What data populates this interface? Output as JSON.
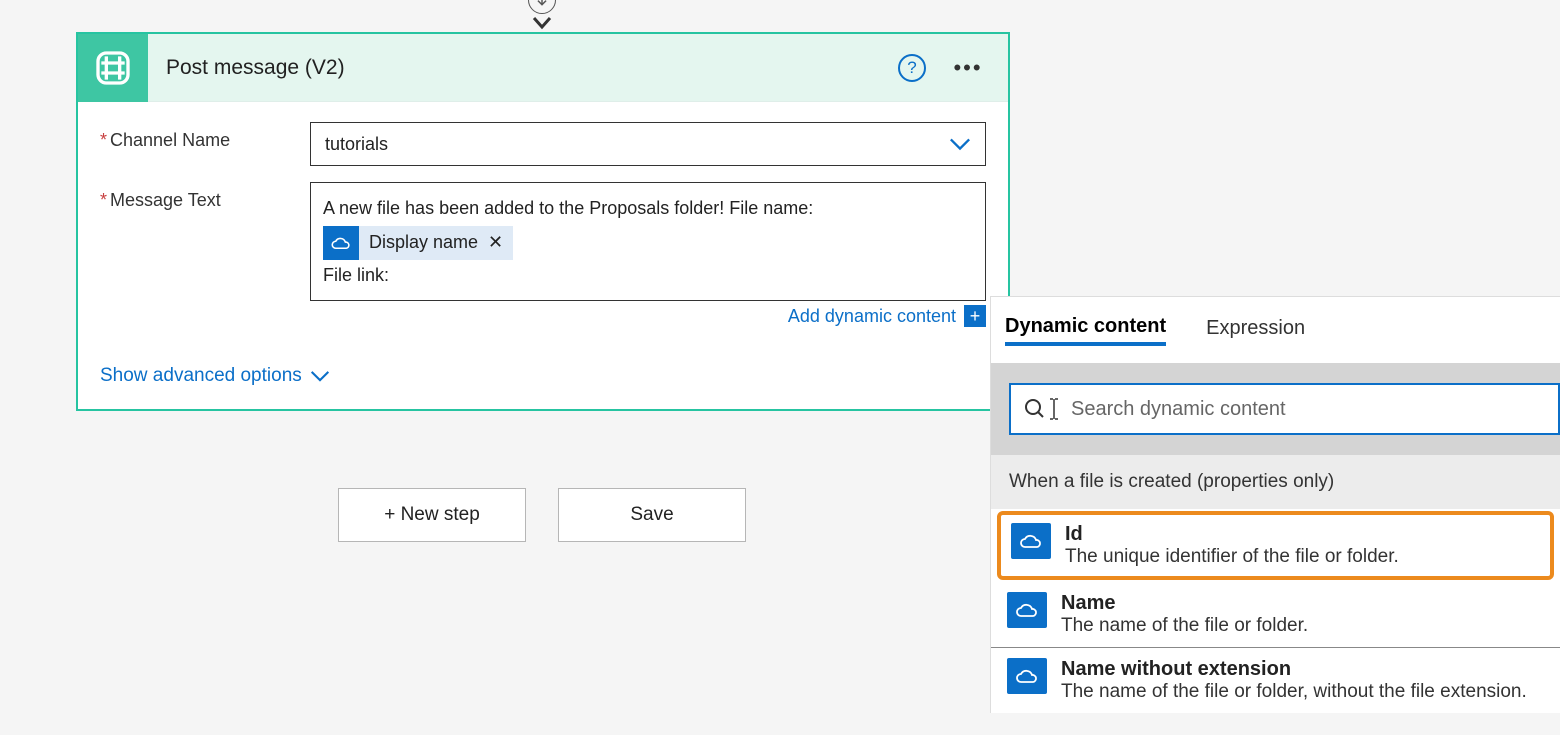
{
  "connector_icon": "arrow-down",
  "card": {
    "title": "Post message (V2)",
    "channel_label": "Channel Name",
    "channel_value": "tutorials",
    "message_label": "Message Text",
    "message_text_before": "A new file has been added to the Proposals folder!  File name:",
    "token_label": "Display name",
    "message_text_after": "File link:",
    "add_dynamic": "Add dynamic content",
    "advanced": "Show advanced options"
  },
  "footer": {
    "new_step": "+ New step",
    "save": "Save"
  },
  "panel": {
    "tab_dynamic": "Dynamic content",
    "tab_expression": "Expression",
    "search_placeholder": "Search dynamic content",
    "group_header": "When a file is created (properties only)",
    "items": [
      {
        "title": "Id",
        "desc": "The unique identifier of the file or folder.",
        "highlight": true
      },
      {
        "title": "Name",
        "desc": "The name of the file or folder.",
        "highlight": false
      },
      {
        "title": "Name without extension",
        "desc": "The name of the file or folder, without the file extension.",
        "highlight": false
      }
    ]
  }
}
